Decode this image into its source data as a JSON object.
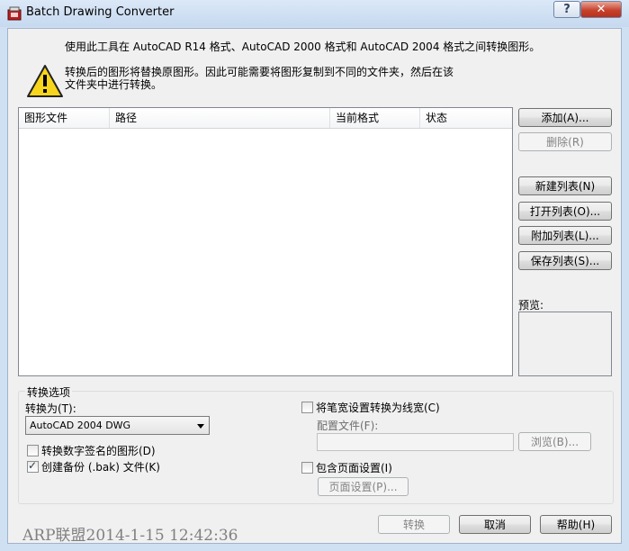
{
  "window": {
    "title": "Batch Drawing Converter"
  },
  "titlebar_buttons": {
    "help": "?",
    "close": "✕"
  },
  "info": {
    "line1": "使用此工具在 AutoCAD R14 格式、AutoCAD 2000 格式和 AutoCAD 2004 格式之间转换图形。",
    "line2": "转换后的图形将替换原图形。因此可能需要将图形复制到不同的文件夹，然后在该文件夹中进行转换。"
  },
  "list": {
    "columns": [
      "图形文件",
      "路径",
      "当前格式",
      "状态"
    ],
    "rows": []
  },
  "side_buttons": {
    "add": "添加(A)...",
    "delete": "删除(R)",
    "new_list": "新建列表(N)",
    "open_list": "打开列表(O)...",
    "append_list": "附加列表(L)...",
    "save_list": "保存列表(S)..."
  },
  "preview": {
    "label": "预览:"
  },
  "options": {
    "group_title": "转换选项",
    "convert_to_label": "转换为(T):",
    "convert_to_value": "AutoCAD 2004 DWG",
    "convert_signed": {
      "label": "转换数字签名的图形(D)",
      "checked": false
    },
    "create_backup": {
      "label": "创建备份 (.bak) 文件(K)",
      "checked": true
    },
    "pen_to_lineweight": {
      "label": "将笔宽设置转换为线宽(C)",
      "checked": false
    },
    "config_file_label": "配置文件(F):",
    "config_file_value": "",
    "browse": "浏览(B)...",
    "include_page_setup": {
      "label": "包含页面设置(I)",
      "checked": false
    },
    "page_setup": "页面设置(P)..."
  },
  "footer": {
    "convert": "转换",
    "cancel": "取消",
    "help": "帮助(H)",
    "watermark": "ARP联盟2014-1-15  12:42:36"
  }
}
